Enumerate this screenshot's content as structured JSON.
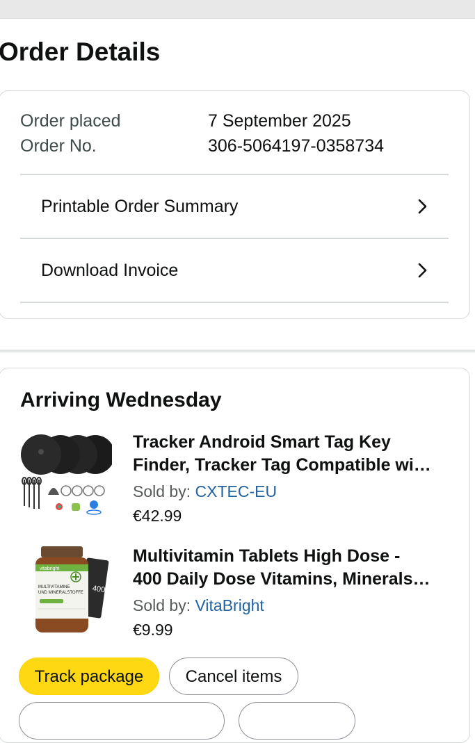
{
  "page": {
    "title": "Order Details"
  },
  "summary": {
    "order_placed_label": "Order placed",
    "order_placed_value": "7 September 2025",
    "order_no_label": "Order No.",
    "order_no_value": "306-5064197-0358734",
    "links": [
      {
        "label": "Printable Order Summary",
        "icon": "chevron-right-icon"
      },
      {
        "label": "Download Invoice",
        "icon": "chevron-right-icon"
      }
    ]
  },
  "shipment": {
    "heading": "Arriving Wednesday",
    "items": [
      {
        "title_line1": "Tracker Android Smart Tag Key",
        "title_line2": "Finder, Tracker Tag Compatible wi…",
        "sold_by_label": "Sold by: ",
        "seller": "CXTEC-EU",
        "price": "€42.99",
        "image": "smart-tag-tracker-product-image"
      },
      {
        "title_line1": "Multivitamin Tablets High Dose -",
        "title_line2": "400 Daily Dose Vitamins, Minerals…",
        "sold_by_label": "Sold by: ",
        "seller": "VitaBright",
        "price": "€9.99",
        "image": "multivitamin-bottle-product-image",
        "image_text": {
          "brand": "vitabright",
          "line1": "MULTIVITAMINE",
          "line2": "UND MINERALSTOFFE",
          "box": "400"
        }
      }
    ],
    "buttons": {
      "track": "Track package",
      "cancel": "Cancel items"
    }
  },
  "colors": {
    "primary_button": "#FFD814",
    "link": "#2162A1",
    "border": "#D5D9D9"
  }
}
